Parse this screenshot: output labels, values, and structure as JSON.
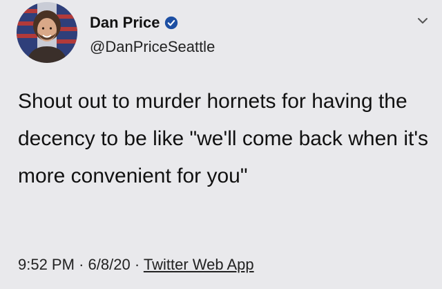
{
  "tweet": {
    "author": {
      "display_name": "Dan Price",
      "handle": "@DanPriceSeattle",
      "verified": true,
      "avatar_icon": "profile-photo-avatar"
    },
    "text": "Shout out to murder hornets for having the decency to be like \"we'll come back when it's more convenient for you\"",
    "time": "9:52 PM",
    "date": "6/8/20",
    "separator": "·",
    "source_app": "Twitter Web App"
  },
  "icons": {
    "verified": "verified-badge-icon",
    "menu": "chevron-down-icon"
  },
  "colors": {
    "background": "#e9e9ec",
    "verified_badge": "#1d4fa3",
    "text": "#111111"
  }
}
